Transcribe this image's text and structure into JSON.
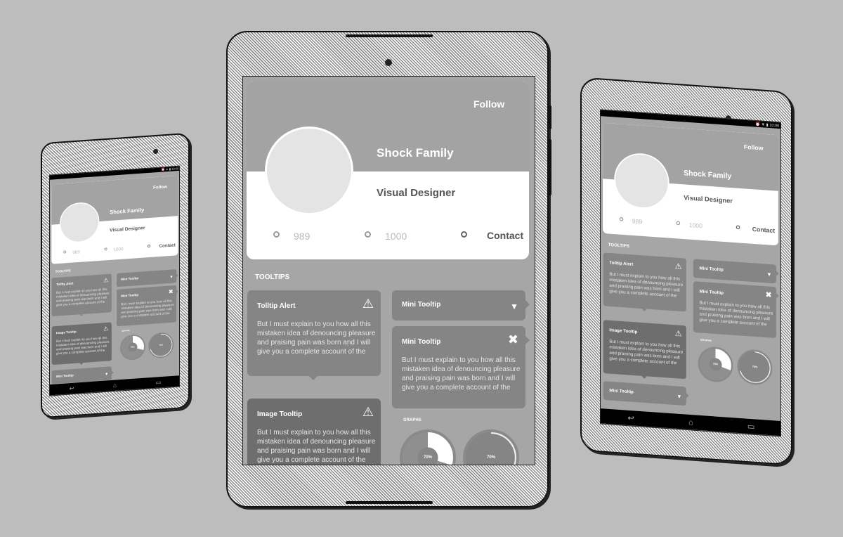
{
  "status_bar": {
    "time": "10:00"
  },
  "profile": {
    "follow_label": "Follow",
    "name": "Shock Family",
    "role": "Visual Designer",
    "twitter_count": "989",
    "facebook_count": "1000",
    "contact_label": "Contact",
    "icons": [
      "twitter-icon",
      "facebook-icon",
      "email-icon"
    ]
  },
  "tooltips": {
    "section_title": "TOOLTIPS",
    "alert": {
      "title": "Tolltip Alert",
      "body": "But I must explain to you how all this mistaken idea of denouncing pleasure and praising pain was born and I will give you a complete account of the",
      "icon": "warning-icon"
    },
    "mini1": {
      "title": "Mini Tooltip",
      "icon": "chevron-down-icon"
    },
    "mini2": {
      "title": "Mini Tooltip",
      "body": "But I must explain to you how all this mistaken idea of denouncing pleasure and praising pain was born and I will give you a complete account of the",
      "icon": "close-icon"
    },
    "image": {
      "title": "Image Tooltip",
      "body": "But I must explain to you how all this mistaken idea of denouncing pleasure and praising pain was born and I will give you a complete account of the",
      "icon": "warning-icon"
    },
    "mini3": {
      "title": "Mini Tooltip",
      "icon": "chevron-down-icon"
    }
  },
  "graphs": {
    "section_title": "GRAPHS",
    "donut1": {
      "label": "70%",
      "value": 30
    },
    "donut2": {
      "label": "70%",
      "value": 70
    }
  },
  "navbar": {
    "back": "↩",
    "home": "⌂",
    "recent": "▭"
  }
}
